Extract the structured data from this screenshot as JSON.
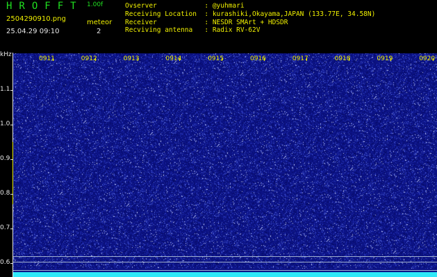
{
  "header": {
    "app_title": "HROFFT",
    "version": "1.00f",
    "filename": "2504290910.png",
    "datetime": "25.04.29 09:10",
    "meteor_label": "meteor",
    "meteor_count": "2"
  },
  "info": [
    "Ovserver            : @yuhmari",
    "Receiving Location  : kurashiki,Okayama,JAPAN (133.77E, 34.58N)",
    "Receiver            : NESDR SMArt + HDSDR",
    "Recviving antenna   : Radix RV-62V"
  ],
  "axis": {
    "y_unit": "kHz",
    "y_ticks": [
      "1.1",
      "1.0",
      "0.9",
      "0.8",
      "0.7",
      "0.6"
    ],
    "x_ticks": [
      "0911",
      "0912",
      "0913",
      "0914",
      "0915",
      "0916",
      "0917",
      "0918",
      "0919",
      "0920"
    ]
  },
  "colors": {
    "background": "#000000",
    "waterfall": "#0c1386",
    "title_green": "#20e020",
    "tick_yellow": "#f0f000",
    "spectrum_cyan": "#30e8f8"
  }
}
